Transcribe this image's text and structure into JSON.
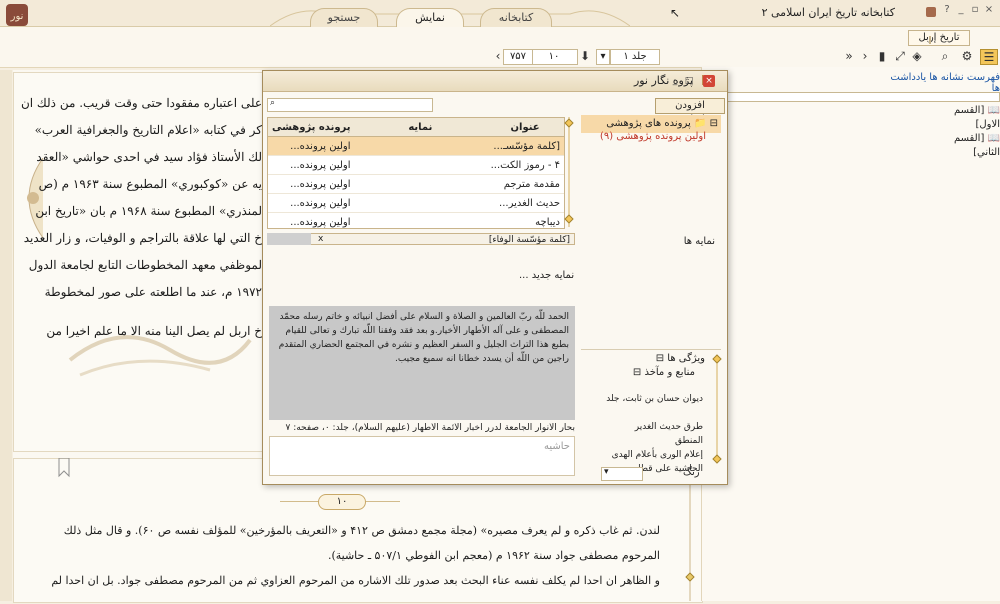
{
  "app": {
    "title": "کتابخانه تاریخ ایران اسلامی ۲",
    "window_buttons": [
      "?",
      "_",
      "▫",
      "×"
    ]
  },
  "tabs": [
    {
      "label": "کتابخانه"
    },
    {
      "label": "نمایش"
    },
    {
      "label": "جستجو"
    }
  ],
  "book_tab": "تاریخ إربل",
  "toolbar": {
    "volume": "جلد ۱",
    "page": "۱۰",
    "total": "۷۵۷"
  },
  "reading": {
    "top_lines": [
      "على اعتباره مفقودا حتى وقت قريب. من ذلك ان",
      "كر في كتابه «اعلام التاريخ والجغرافية العرب»",
      "لك الأستاذ فؤاد سيد في احدى حواشي «العقد",
      "يه عن «كوكبوري» المطبوع سنة ۱۹۶۳ م (ص",
      "لمنذري» المطبوع سنة ۱۹۶۸ م بان «تاريخ ابن",
      "خ التي لها علاقة بالتراجم و الوفيات، و زار العديد",
      "لموظفي معهد المخطوطات التابع لجامعة الدول",
      "۱۹۷۲ م، عند ما اطلعته على صور لمخطوطة",
      "خ اربل لم يصل الينا منه الا ما علم اخيرا من"
    ],
    "page_number": "۱۰",
    "bottom_lines": [
      "لندن. ثم غاب ذكره و لم يعرف مصيره» (مجلة مجمع دمشق ص ۴۱۲ و «التعريف بالمؤرخين» للمؤلف نفسه ص ۶۰). و قال مثل ذلك",
      "المرحوم مصطفى جواد سنة ۱۹۶۲ م (معجم ابن الفوطي ۵۰۷/۱ ـ حاشية).",
      "و الظاهر ان احدا لم يكلف نفسه عناء البحث بعد صدور تلك الاشاره من المرحوم العزاوي ثم من المرحوم مصطفى جواد. بل ان احدا لم"
    ]
  },
  "right_panel": {
    "tabs": [
      "فهرست",
      "نشانه ها",
      "یادداشت ها"
    ],
    "toc": [
      "[القسم الاول]",
      "[القسم الثاني]"
    ]
  },
  "dialog": {
    "title": "پژوه نگار نور",
    "add_note_button": "افزودن یادداشت",
    "search_placeholder": "",
    "columns": [
      "عنوان",
      "نمايه",
      "پرونده پژوهشی"
    ],
    "rows": [
      {
        "title": "[كلمة مؤسّسـ...",
        "index": "",
        "file": "اولین پرونده..."
      },
      {
        "title": "۴ - رموز الكت...",
        "index": "",
        "file": "اولین پرونده..."
      },
      {
        "title": "مقدمة مترجم",
        "index": "",
        "file": "اولین پرونده..."
      },
      {
        "title": "حديث الغدير...",
        "index": "",
        "file": "اولین پرونده..."
      },
      {
        "title": "ديباچه",
        "index": "",
        "file": "اولین پرونده..."
      }
    ],
    "tree_root": "پرونده های پژوهشی",
    "tree_child": "اولین پرونده پژوهشی (۹)",
    "selected_tag": "[كلمة مؤسّسة الوفاء]",
    "index_label": "نمایه ها",
    "new_index": "نمایه جدید ...",
    "quote": "الحمد للّه ربّ العالمين و الصلاة و السلام على أفضل انبيائه و خاتم رسله محمّد المصطفى و على آله الأطهار الأخيار.و بعد فقد وفقنا اللّه تبارك و تعالى للقيام بطبع هذا التراث الجليل و السفر العظيم و نشره في المجتمع الحضاري المتقدم راجين من اللّه أن يسدد خطانا انه سميع مجيب.",
    "source": "بحار الأنوار الجامعة لدرر أخبار الأئمة الأطهار (عليهم السلام)، جلد: ۰، صفحه: ۷",
    "margin_placeholder": "حاشیه",
    "features_label": "ویژگی ها",
    "sources_label": "منابع و مآخذ",
    "sources": [
      "ديوان حسان بن ثابت، جلد",
      "طرق حديث الغدير",
      "المنطق",
      "إعلام الورى بأعلام الهدى",
      "الحاشية على قطان..."
    ],
    "color_label": "رنگ"
  }
}
